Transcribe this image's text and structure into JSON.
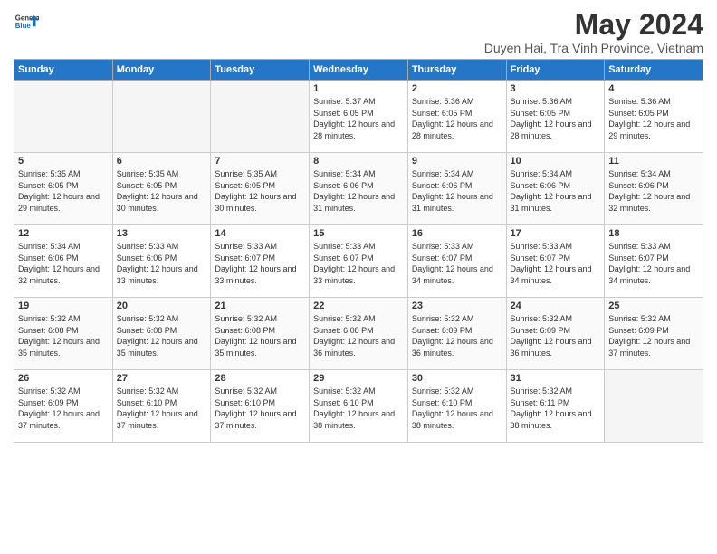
{
  "logo": {
    "line1": "General",
    "line2": "Blue"
  },
  "title": "May 2024",
  "subtitle": "Duyen Hai, Tra Vinh Province, Vietnam",
  "headers": [
    "Sunday",
    "Monday",
    "Tuesday",
    "Wednesday",
    "Thursday",
    "Friday",
    "Saturday"
  ],
  "weeks": [
    [
      {
        "day": "",
        "info": ""
      },
      {
        "day": "",
        "info": ""
      },
      {
        "day": "",
        "info": ""
      },
      {
        "day": "1",
        "info": "Sunrise: 5:37 AM\nSunset: 6:05 PM\nDaylight: 12 hours and 28 minutes."
      },
      {
        "day": "2",
        "info": "Sunrise: 5:36 AM\nSunset: 6:05 PM\nDaylight: 12 hours and 28 minutes."
      },
      {
        "day": "3",
        "info": "Sunrise: 5:36 AM\nSunset: 6:05 PM\nDaylight: 12 hours and 28 minutes."
      },
      {
        "day": "4",
        "info": "Sunrise: 5:36 AM\nSunset: 6:05 PM\nDaylight: 12 hours and 29 minutes."
      }
    ],
    [
      {
        "day": "5",
        "info": "Sunrise: 5:35 AM\nSunset: 6:05 PM\nDaylight: 12 hours and 29 minutes."
      },
      {
        "day": "6",
        "info": "Sunrise: 5:35 AM\nSunset: 6:05 PM\nDaylight: 12 hours and 30 minutes."
      },
      {
        "day": "7",
        "info": "Sunrise: 5:35 AM\nSunset: 6:05 PM\nDaylight: 12 hours and 30 minutes."
      },
      {
        "day": "8",
        "info": "Sunrise: 5:34 AM\nSunset: 6:06 PM\nDaylight: 12 hours and 31 minutes."
      },
      {
        "day": "9",
        "info": "Sunrise: 5:34 AM\nSunset: 6:06 PM\nDaylight: 12 hours and 31 minutes."
      },
      {
        "day": "10",
        "info": "Sunrise: 5:34 AM\nSunset: 6:06 PM\nDaylight: 12 hours and 31 minutes."
      },
      {
        "day": "11",
        "info": "Sunrise: 5:34 AM\nSunset: 6:06 PM\nDaylight: 12 hours and 32 minutes."
      }
    ],
    [
      {
        "day": "12",
        "info": "Sunrise: 5:34 AM\nSunset: 6:06 PM\nDaylight: 12 hours and 32 minutes."
      },
      {
        "day": "13",
        "info": "Sunrise: 5:33 AM\nSunset: 6:06 PM\nDaylight: 12 hours and 33 minutes."
      },
      {
        "day": "14",
        "info": "Sunrise: 5:33 AM\nSunset: 6:07 PM\nDaylight: 12 hours and 33 minutes."
      },
      {
        "day": "15",
        "info": "Sunrise: 5:33 AM\nSunset: 6:07 PM\nDaylight: 12 hours and 33 minutes."
      },
      {
        "day": "16",
        "info": "Sunrise: 5:33 AM\nSunset: 6:07 PM\nDaylight: 12 hours and 34 minutes."
      },
      {
        "day": "17",
        "info": "Sunrise: 5:33 AM\nSunset: 6:07 PM\nDaylight: 12 hours and 34 minutes."
      },
      {
        "day": "18",
        "info": "Sunrise: 5:33 AM\nSunset: 6:07 PM\nDaylight: 12 hours and 34 minutes."
      }
    ],
    [
      {
        "day": "19",
        "info": "Sunrise: 5:32 AM\nSunset: 6:08 PM\nDaylight: 12 hours and 35 minutes."
      },
      {
        "day": "20",
        "info": "Sunrise: 5:32 AM\nSunset: 6:08 PM\nDaylight: 12 hours and 35 minutes."
      },
      {
        "day": "21",
        "info": "Sunrise: 5:32 AM\nSunset: 6:08 PM\nDaylight: 12 hours and 35 minutes."
      },
      {
        "day": "22",
        "info": "Sunrise: 5:32 AM\nSunset: 6:08 PM\nDaylight: 12 hours and 36 minutes."
      },
      {
        "day": "23",
        "info": "Sunrise: 5:32 AM\nSunset: 6:09 PM\nDaylight: 12 hours and 36 minutes."
      },
      {
        "day": "24",
        "info": "Sunrise: 5:32 AM\nSunset: 6:09 PM\nDaylight: 12 hours and 36 minutes."
      },
      {
        "day": "25",
        "info": "Sunrise: 5:32 AM\nSunset: 6:09 PM\nDaylight: 12 hours and 37 minutes."
      }
    ],
    [
      {
        "day": "26",
        "info": "Sunrise: 5:32 AM\nSunset: 6:09 PM\nDaylight: 12 hours and 37 minutes."
      },
      {
        "day": "27",
        "info": "Sunrise: 5:32 AM\nSunset: 6:10 PM\nDaylight: 12 hours and 37 minutes."
      },
      {
        "day": "28",
        "info": "Sunrise: 5:32 AM\nSunset: 6:10 PM\nDaylight: 12 hours and 37 minutes."
      },
      {
        "day": "29",
        "info": "Sunrise: 5:32 AM\nSunset: 6:10 PM\nDaylight: 12 hours and 38 minutes."
      },
      {
        "day": "30",
        "info": "Sunrise: 5:32 AM\nSunset: 6:10 PM\nDaylight: 12 hours and 38 minutes."
      },
      {
        "day": "31",
        "info": "Sunrise: 5:32 AM\nSunset: 6:11 PM\nDaylight: 12 hours and 38 minutes."
      },
      {
        "day": "",
        "info": ""
      }
    ]
  ]
}
